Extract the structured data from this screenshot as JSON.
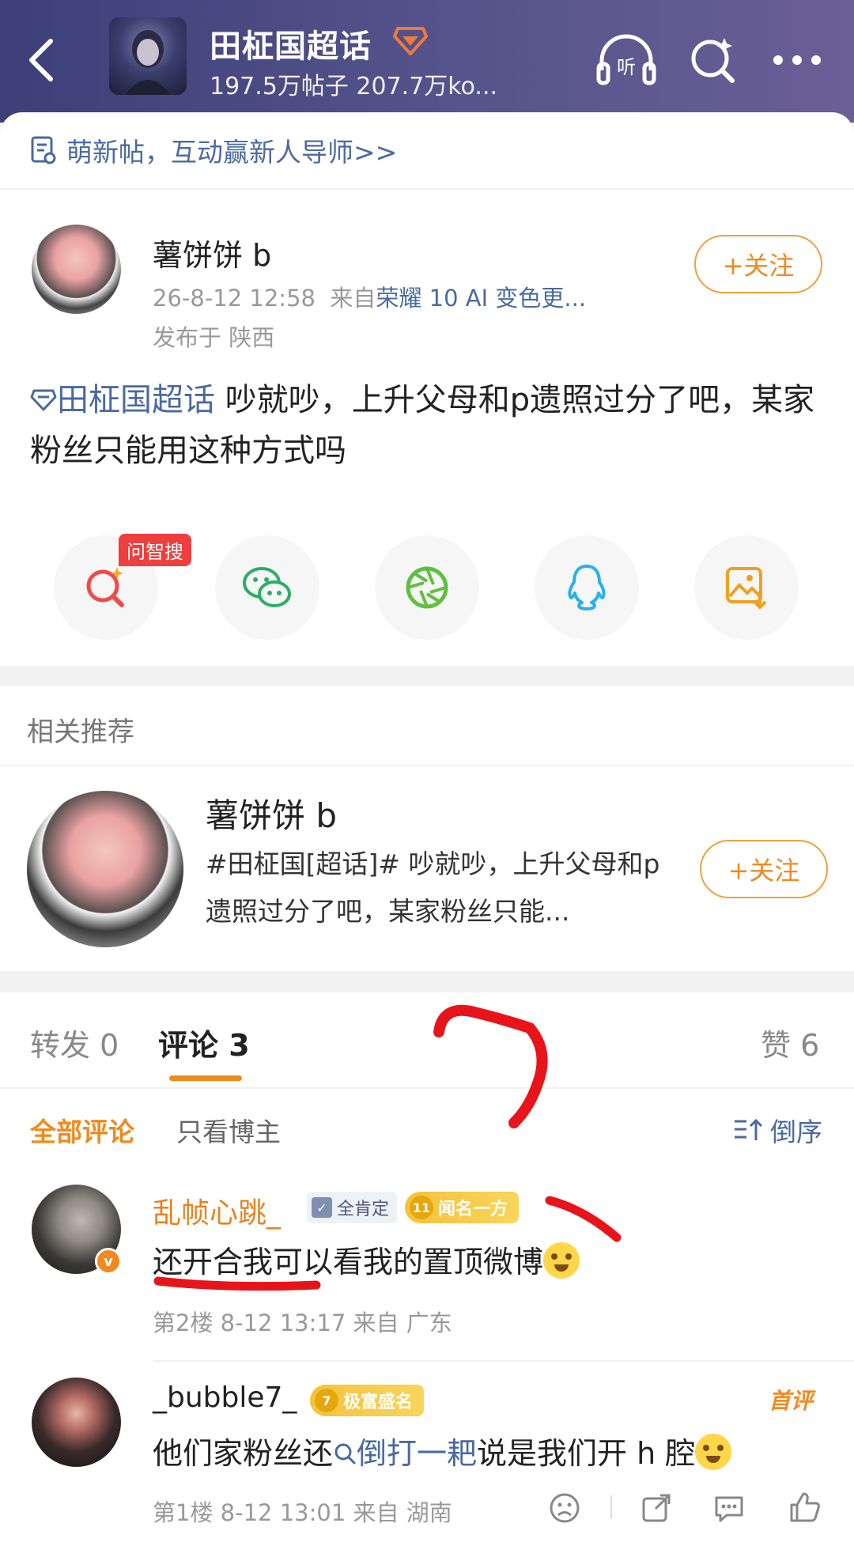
{
  "header": {
    "title": "田柾国超话",
    "stats": "197.5万帖子 207.7万ko...",
    "listen_label": "听"
  },
  "banner": {
    "text": "萌新帖，互动赢新人导师>>"
  },
  "post": {
    "author": "薯饼饼 b",
    "time": "26-8-12 12:58",
    "from_label": "来自",
    "source": "荣耀 10 AI 变色更...",
    "location": "发布于 陕西",
    "follow_label": "+关注",
    "topic": "田柾国超话",
    "text": " 吵就吵，上升父母和p遗照过分了吧，某家粉丝只能用这种方式吗",
    "ask_tag": "问智搜"
  },
  "share_icons": [
    "ai-search-icon",
    "wechat-icon",
    "moments-icon",
    "qq-icon",
    "save-image-icon"
  ],
  "related": {
    "title": "相关推荐",
    "name": "薯饼饼 b",
    "text": "#田柾国[超话]# 吵就吵，上升父母和p遗照过分了吧，某家粉丝只能...",
    "follow_label": "+关注"
  },
  "tabs": {
    "repost": "转发 0",
    "comment": "评论 3",
    "like": "赞 6"
  },
  "filters": {
    "all": "全部评论",
    "owner_only": "只看博主",
    "sort": "倒序"
  },
  "comments": [
    {
      "name": "乱帧心跳_",
      "tag1": "全肯定",
      "tag2_level": "11",
      "tag2": "闻名一方",
      "text": "还开合我可以看我的置顶微博",
      "meta": "第2楼 8-12 13:17 来自 广东"
    },
    {
      "name": "_bubble7_",
      "tag_level": "7",
      "tag": "极富盛名",
      "first_label": "首评",
      "text_pre": "他们家粉丝还",
      "text_topic": "倒打一耙",
      "text_post": "说是我们开 h 腔",
      "meta": "第1楼 8-12 13:01 来自 湖南"
    }
  ],
  "colors": {
    "header_start": "#3d3f79",
    "header_end": "#6a5f96",
    "accent_orange": "#f08a1c",
    "link_blue": "#4a6aa0",
    "annotation_red": "#e8141b"
  }
}
